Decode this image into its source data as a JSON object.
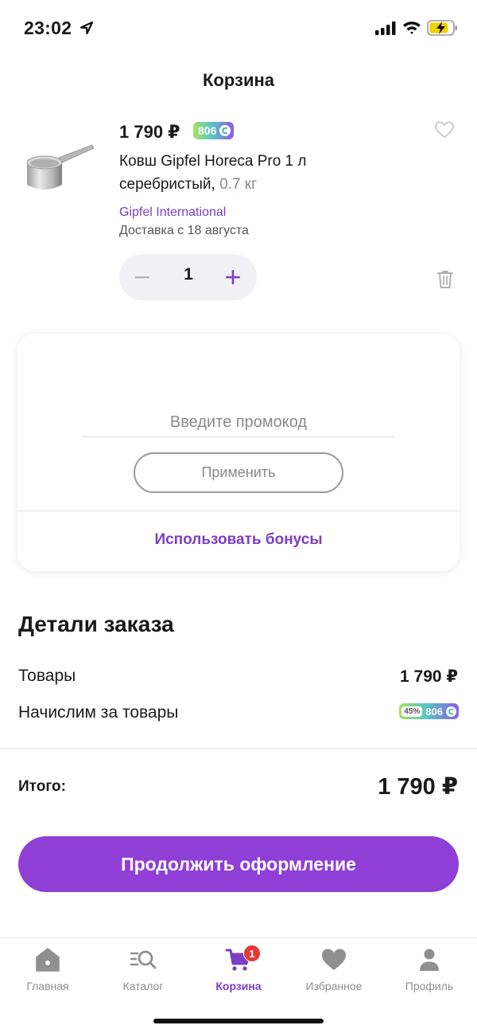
{
  "status_bar": {
    "time": "23:02"
  },
  "header": {
    "title": "Корзина"
  },
  "cart_item": {
    "price": "1 790 ₽",
    "bonus": "806",
    "name": "Ковш Gipfel Horeca Pro 1 л серебристый,",
    "weight": "0.7 кг",
    "seller": "Gipfel International",
    "delivery": "Доставка с 18 августа",
    "quantity": "1"
  },
  "promo": {
    "placeholder": "Введите промокод",
    "apply_label": "Применить",
    "use_bonus_label": "Использовать бонусы"
  },
  "order_details": {
    "title": "Детали заказа",
    "goods_label": "Товары",
    "goods_value": "1 790 ₽",
    "accrue_label": "Начислим за товары",
    "accrue_percent": "45%",
    "accrue_value": "806",
    "total_label": "Итого:",
    "total_value": "1 790 ₽"
  },
  "checkout": {
    "label": "Продолжить оформление"
  },
  "tab_bar": {
    "items": [
      {
        "label": "Главная",
        "icon": "home-icon"
      },
      {
        "label": "Каталог",
        "icon": "catalog-search-icon"
      },
      {
        "label": "Корзина",
        "icon": "cart-icon",
        "badge": "1",
        "active": true
      },
      {
        "label": "Избранное",
        "icon": "heart-icon"
      },
      {
        "label": "Профиль",
        "icon": "profile-icon"
      }
    ]
  },
  "colors": {
    "accent": "#8f3fd6",
    "link": "#7b3fc4",
    "badge": "#e53935"
  }
}
